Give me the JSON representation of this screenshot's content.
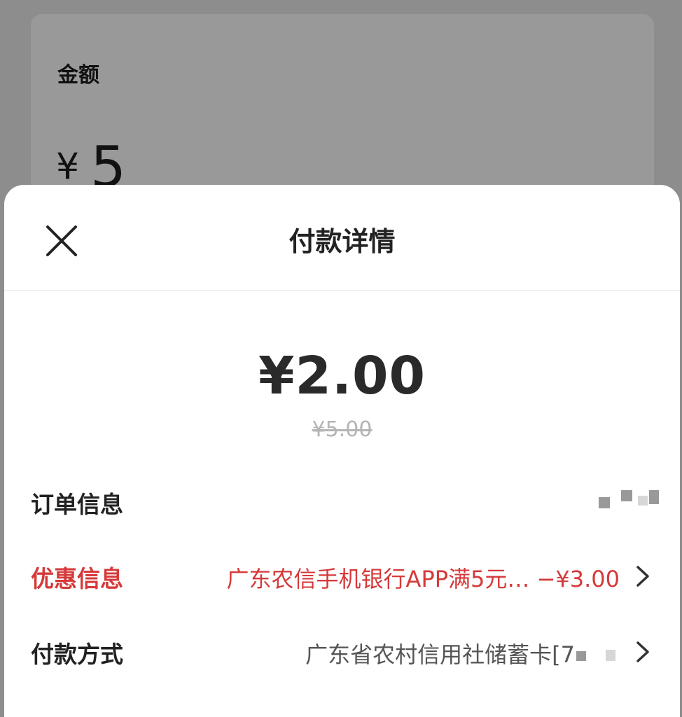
{
  "background": {
    "label": "金额",
    "currency": "¥",
    "amount": "5"
  },
  "sheet": {
    "title": "付款详情",
    "close_icon": "close-icon",
    "amount": "¥2.00",
    "original_amount": "¥5.00",
    "rows": [
      {
        "label": "订单信息",
        "value": ""
      },
      {
        "label": "优惠信息",
        "value": "广东农信手机银行APP满5元… −¥3.00",
        "chevron": "chevron-right-icon"
      },
      {
        "label": "付款方式",
        "value": "广东省农村信用社储蓄卡[7",
        "chevron": "chevron-right-icon"
      }
    ]
  },
  "colors": {
    "discount_red": "#d53a3a",
    "overlay_gray": "#8d8d8d"
  }
}
